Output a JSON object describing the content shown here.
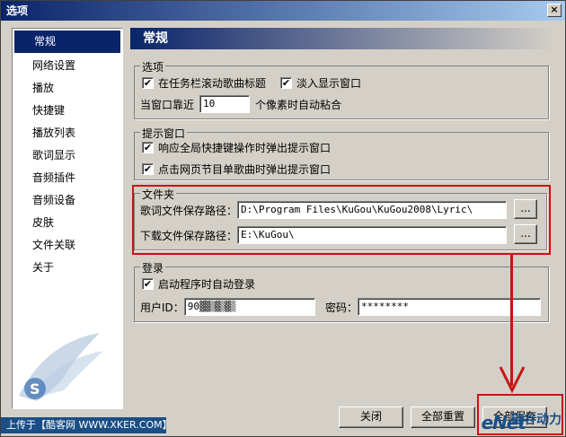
{
  "window": {
    "title": "选项",
    "close_glyph": "×"
  },
  "nav": {
    "items": [
      "常规",
      "网络设置",
      "播放",
      "快捷键",
      "播放列表",
      "歌词显示",
      "音频插件",
      "音频设备",
      "皮肤",
      "文件关联",
      "关于"
    ],
    "selected_index": 0
  },
  "header": {
    "title": "常规"
  },
  "options": {
    "legend": "选项",
    "scroll_title": {
      "label": "在任务栏滚动歌曲标题",
      "checked": true
    },
    "fade_in": {
      "label": "淡入显示窗口",
      "checked": true
    },
    "snap_prefix": "当窗口靠近",
    "snap_value": "10",
    "snap_suffix": "个像素时自动粘合"
  },
  "tips": {
    "legend": "提示窗口",
    "hotkey_popup": {
      "label": "响应全局快捷键操作时弹出提示窗口",
      "checked": true
    },
    "web_popup": {
      "label": "点击网页节目单歌曲时弹出提示窗口",
      "checked": true
    }
  },
  "folders": {
    "legend": "文件夹",
    "lyric_label": "歌词文件保存路径：",
    "lyric_path": "D:\\Program Files\\KuGou\\KuGou2008\\Lyric\\",
    "download_label": "下载文件保存路径：",
    "download_path": "E:\\KuGou\\",
    "browse_label": "..."
  },
  "login": {
    "legend": "登录",
    "auto_login": {
      "label": "启动程序时自动登录",
      "checked": true
    },
    "user_label": "用户ID：",
    "user_value": "90",
    "password_label": "密码：",
    "password_value": "********"
  },
  "buttons": {
    "close": "关闭",
    "reset_all": "全部重置",
    "save_all": "全部保存"
  },
  "watermark": {
    "upload_text": "上传于【酷客网 WWW.XKER.COM】",
    "enet": "eNet",
    "enet_cn": "硅谷动力"
  },
  "colors": {
    "accent": "#0a246a",
    "highlight": "#c81414",
    "face": "#d4d0c8"
  }
}
